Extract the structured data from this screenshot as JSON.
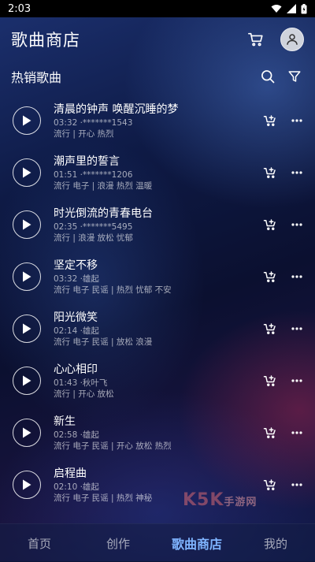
{
  "status": {
    "time": "2:03"
  },
  "header": {
    "title": "歌曲商店",
    "cart_icon": "cart-icon",
    "avatar_icon": "user-avatar-icon"
  },
  "section": {
    "title": "热销歌曲",
    "search_icon": "search-icon",
    "filter_icon": "filter-icon"
  },
  "songs": [
    {
      "title": "清晨的钟声 唤醒沉睡的梦",
      "meta": "03:32 ·*******1543",
      "tags": "流行 | 开心 热烈"
    },
    {
      "title": "潮声里的誓言",
      "meta": "01:51 ·*******1206",
      "tags": "流行 电子 | 浪漫 热烈 温暖"
    },
    {
      "title": "时光倒流的青春电台",
      "meta": "02:35 ·*******5495",
      "tags": "流行 | 浪漫 放松 忧郁"
    },
    {
      "title": "坚定不移",
      "meta": "03:32 ·雄起",
      "tags": "流行 电子 民谣 | 热烈 忧郁 不安"
    },
    {
      "title": "阳光微笑",
      "meta": "02:14 ·雄起",
      "tags": "流行 电子 民谣 | 放松 浪漫"
    },
    {
      "title": "心心相印",
      "meta": "01:43 ·秋叶飞",
      "tags": "流行 | 开心 放松"
    },
    {
      "title": "新生",
      "meta": "02:58 ·雄起",
      "tags": "流行 电子 民谣 | 开心 放松 热烈"
    },
    {
      "title": "启程曲",
      "meta": "02:10 ·雄起",
      "tags": "流行 电子 民谣 | 热烈 神秘"
    }
  ],
  "watermark": {
    "brand": "K5K",
    "sub": "手游网"
  },
  "nav": {
    "items": [
      "首页",
      "创作",
      "歌曲商店",
      "我的"
    ],
    "active_index": 2,
    "active_color": "#7fb4ff"
  }
}
